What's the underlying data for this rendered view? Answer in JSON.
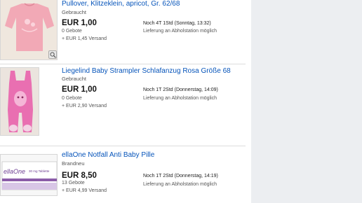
{
  "listings": [
    {
      "title": "Pullover, Klitzeklein, apricot, Gr. 62/68",
      "condition": "Gebraucht",
      "price": "EUR 1,00",
      "bids": "0 Gebote",
      "shipping": "+ EUR 1,45 Versand",
      "time_left": "Noch 4T 1Std (Sonntag, 13:32)",
      "pickup": "Lieferung an Abholstation möglich"
    },
    {
      "title": "Liegelind Baby Strampler Schlafanzug Rosa Größe 68",
      "condition": "Gebraucht",
      "price": "EUR 1,00",
      "bids": "0 Gebote",
      "shipping": "+ EUR 2,90 Versand",
      "time_left": "Noch 1T 2Std (Donnerstag, 14:09)",
      "pickup": "Lieferung an Abholstation möglich"
    },
    {
      "title": "ellaOne Notfall Anti Baby Pille",
      "condition": "Brandneu",
      "price": "EUR 8,50",
      "bids": "13 Gebote",
      "shipping": "+ EUR 4,99 Versand",
      "time_left": "Noch 1T 2Std (Donnerstag, 14:19)",
      "pickup": "Lieferung an Abholstation möglich"
    }
  ],
  "thumbnail_text": {
    "ellaone_logo": "ellaOne",
    "ellaone_sub": "30 mg Tablette"
  },
  "colors": {
    "link": "#0654ba",
    "panel_bg": "#eceef1"
  }
}
